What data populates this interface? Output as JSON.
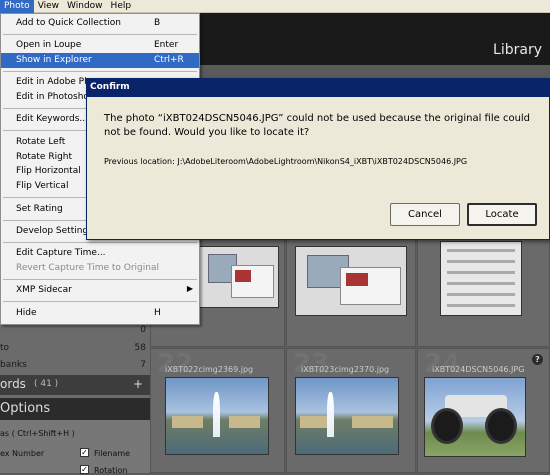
{
  "menubar": {
    "items": [
      "Photo",
      "View",
      "Window",
      "Help"
    ]
  },
  "banner": {
    "title": "Library"
  },
  "photo_menu": {
    "items": [
      {
        "label": "Add to Quick Collection",
        "shortcut": "B"
      },
      {
        "label": "Open in Loupe",
        "shortcut": "Enter"
      },
      {
        "label": "Show in Explorer",
        "shortcut": "Ctrl+R"
      },
      {
        "label": "Edit in Adobe Ph"
      },
      {
        "label": "Edit in Photoshop"
      },
      {
        "label": "Edit Keywords..."
      },
      {
        "label": "Rotate Left"
      },
      {
        "label": "Rotate Right"
      },
      {
        "label": "Flip Horizontal"
      },
      {
        "label": "Flip Vertical"
      },
      {
        "label": "Set Rating"
      },
      {
        "label": "Develop Settings"
      },
      {
        "label": "Edit Capture Time..."
      },
      {
        "label": "Revert Capture Time to Original"
      },
      {
        "label": "XMP Sidecar"
      },
      {
        "label": "Hide",
        "shortcut": "H"
      }
    ]
  },
  "dialog": {
    "title": "Confirm",
    "message": "The photo “iXBT024DSCN5046.JPG” could not be used because the original file could not be found. Would you like to locate it?",
    "previous_location": "Previous location: J:\\AdobeLiteroom\\AdobeLightroom\\NikonS4_iXBT\\iXBT024DSCN5046.JPG",
    "cancel_label": "Cancel",
    "locate_label": "Locate"
  },
  "grid": {
    "cells": [
      {
        "number": "22",
        "filename": "iXBT022cimg2369.jpg"
      },
      {
        "number": "23",
        "filename": "iXBT023cimg2370.jpg"
      },
      {
        "number": "24",
        "filename": "iXBT024DSCN5046.JPG"
      }
    ],
    "info_icon": "?"
  },
  "left_panel": {
    "rows": [
      {
        "label": "",
        "value": "0"
      },
      {
        "label": "to",
        "value": "58"
      },
      {
        "label": "banks",
        "value": "7"
      }
    ],
    "keywords": {
      "title": "ords",
      "count": "( 41 )",
      "add": "+"
    },
    "options": {
      "title": "Options",
      "shortcut_hint": "as  ( Ctrl+Shift+H )",
      "index_number": "ex Number",
      "filename": "Filename",
      "rotation": "Rotation"
    }
  }
}
